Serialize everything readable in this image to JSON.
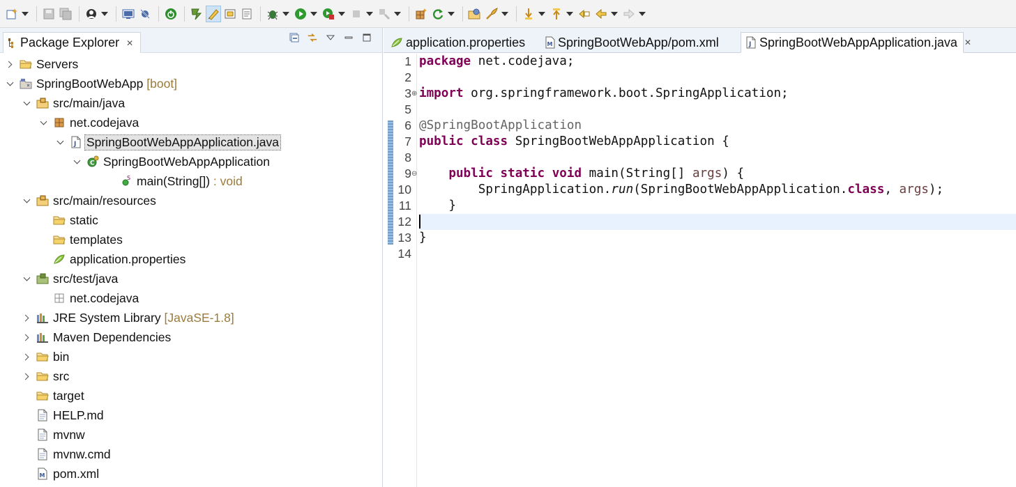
{
  "toolbar": {
    "buttons": [
      "new-wizard-icon",
      "save-icon",
      "save-all-icon",
      "perspective-icon",
      "console-icon",
      "skip-breakpoints-icon",
      "spring-boot-dashboard-icon",
      "open-task-icon",
      "toggle-mark-occurrences-icon",
      "toggle-block-selection-icon",
      "show-whitespace-icon",
      "debug-icon",
      "run-icon",
      "coverage-icon",
      "stop-icon",
      "external-tools-icon",
      "new-java-package-icon",
      "refresh-icon",
      "open-type-icon",
      "spring-icon",
      "next-annotation-icon",
      "previous-annotation-icon",
      "last-edit-location-icon",
      "back-icon",
      "forward-icon"
    ],
    "active_button": "toggle-mark-occurrences-icon"
  },
  "explorer": {
    "title": "Package Explorer",
    "tree": [
      {
        "label": "Servers",
        "decor": "",
        "icon": "folder-icon",
        "twisty": "collapsed"
      },
      {
        "label": "SpringBootWebApp",
        "decor": "[boot]",
        "icon": "project-icon",
        "twisty": "expanded"
      },
      {
        "label": "src/main/java",
        "decor": "",
        "icon": "source-folder-icon",
        "twisty": "expanded"
      },
      {
        "label": "net.codejava",
        "decor": "",
        "icon": "package-icon",
        "twisty": "expanded"
      },
      {
        "label": "SpringBootWebAppApplication.java",
        "decor": "",
        "icon": "java-file-icon",
        "twisty": "expanded",
        "selected": true
      },
      {
        "label": "SpringBootWebAppApplication",
        "decor": "",
        "icon": "class-icon",
        "twisty": "expanded"
      },
      {
        "label": "main(String[])",
        "decor": ": void",
        "icon": "method-icon",
        "twisty": "none"
      },
      {
        "label": "src/main/resources",
        "decor": "",
        "icon": "source-folder-icon",
        "twisty": "expanded"
      },
      {
        "label": "static",
        "decor": "",
        "icon": "folder-icon",
        "twisty": "none"
      },
      {
        "label": "templates",
        "decor": "",
        "icon": "folder-icon",
        "twisty": "none"
      },
      {
        "label": "application.properties",
        "decor": "",
        "icon": "properties-icon",
        "twisty": "none"
      },
      {
        "label": "src/test/java",
        "decor": "",
        "icon": "test-source-folder-icon",
        "twisty": "expanded"
      },
      {
        "label": "net.codejava",
        "decor": "",
        "icon": "empty-package-icon",
        "twisty": "none"
      },
      {
        "label": "JRE System Library",
        "decor": "[JavaSE-1.8]",
        "icon": "library-icon",
        "twisty": "collapsed"
      },
      {
        "label": "Maven Dependencies",
        "decor": "",
        "icon": "library-icon",
        "twisty": "collapsed"
      },
      {
        "label": "bin",
        "decor": "",
        "icon": "folder-icon",
        "twisty": "collapsed"
      },
      {
        "label": "src",
        "decor": "",
        "icon": "folder-icon",
        "twisty": "collapsed"
      },
      {
        "label": "target",
        "decor": "",
        "icon": "folder-icon",
        "twisty": "none"
      },
      {
        "label": "HELP.md",
        "decor": "",
        "icon": "file-icon",
        "twisty": "none"
      },
      {
        "label": "mvnw",
        "decor": "",
        "icon": "file-icon",
        "twisty": "none"
      },
      {
        "label": "mvnw.cmd",
        "decor": "",
        "icon": "file-icon",
        "twisty": "none"
      },
      {
        "label": "pom.xml",
        "decor": "",
        "icon": "maven-pom-icon",
        "twisty": "none"
      }
    ]
  },
  "editor": {
    "tabs": [
      {
        "label": "application.properties",
        "icon": "properties-icon",
        "active": false
      },
      {
        "label": "SpringBootWebApp/pom.xml",
        "icon": "maven-pom-icon",
        "active": false
      },
      {
        "label": "SpringBootWebAppApplication.java",
        "icon": "java-file-icon",
        "active": true
      }
    ],
    "current_line": 12,
    "lines": [
      {
        "n": "1",
        "fold": "",
        "tokens": [
          {
            "t": "package",
            "c": "kw"
          },
          {
            "t": " net.codejava;",
            "c": ""
          }
        ]
      },
      {
        "n": "2",
        "fold": "",
        "tokens": []
      },
      {
        "n": "3",
        "fold": "⊕",
        "tokens": [
          {
            "t": "import",
            "c": "kw"
          },
          {
            "t": " org.springframework.boot.SpringApplication;",
            "c": ""
          }
        ]
      },
      {
        "n": "5",
        "fold": "",
        "tokens": []
      },
      {
        "n": "6",
        "fold": "",
        "tokens": [
          {
            "t": "@SpringBootApplication",
            "c": "ann"
          }
        ]
      },
      {
        "n": "7",
        "fold": "",
        "tokens": [
          {
            "t": "public",
            "c": "kw"
          },
          {
            "t": " ",
            "c": ""
          },
          {
            "t": "class",
            "c": "kw"
          },
          {
            "t": " SpringBootWebAppApplication {",
            "c": ""
          }
        ]
      },
      {
        "n": "8",
        "fold": "",
        "tokens": []
      },
      {
        "n": "9",
        "fold": "⊖",
        "tokens": [
          {
            "t": "    ",
            "c": ""
          },
          {
            "t": "public",
            "c": "kw"
          },
          {
            "t": " ",
            "c": ""
          },
          {
            "t": "static",
            "c": "kw"
          },
          {
            "t": " ",
            "c": ""
          },
          {
            "t": "void",
            "c": "kw"
          },
          {
            "t": " main(String[] ",
            "c": ""
          },
          {
            "t": "args",
            "c": "param"
          },
          {
            "t": ") {",
            "c": ""
          }
        ]
      },
      {
        "n": "10",
        "fold": "",
        "tokens": [
          {
            "t": "        SpringApplication.",
            "c": ""
          },
          {
            "t": "run",
            "c": "method-static"
          },
          {
            "t": "(SpringBootWebAppApplication.",
            "c": ""
          },
          {
            "t": "class",
            "c": "kw"
          },
          {
            "t": ", ",
            "c": ""
          },
          {
            "t": "args",
            "c": "param"
          },
          {
            "t": ");",
            "c": ""
          }
        ]
      },
      {
        "n": "11",
        "fold": "",
        "tokens": [
          {
            "t": "    }",
            "c": ""
          }
        ]
      },
      {
        "n": "12",
        "fold": "",
        "tokens": []
      },
      {
        "n": "13",
        "fold": "",
        "tokens": [
          {
            "t": "}",
            "c": ""
          }
        ]
      },
      {
        "n": "14",
        "fold": "",
        "tokens": []
      }
    ]
  },
  "colors": {
    "keyword": "#7f0055",
    "annotation": "#646464",
    "parameter": "#6a3e3e",
    "current_line": "#e8f2fe",
    "decoration": "#9b7b3c"
  }
}
